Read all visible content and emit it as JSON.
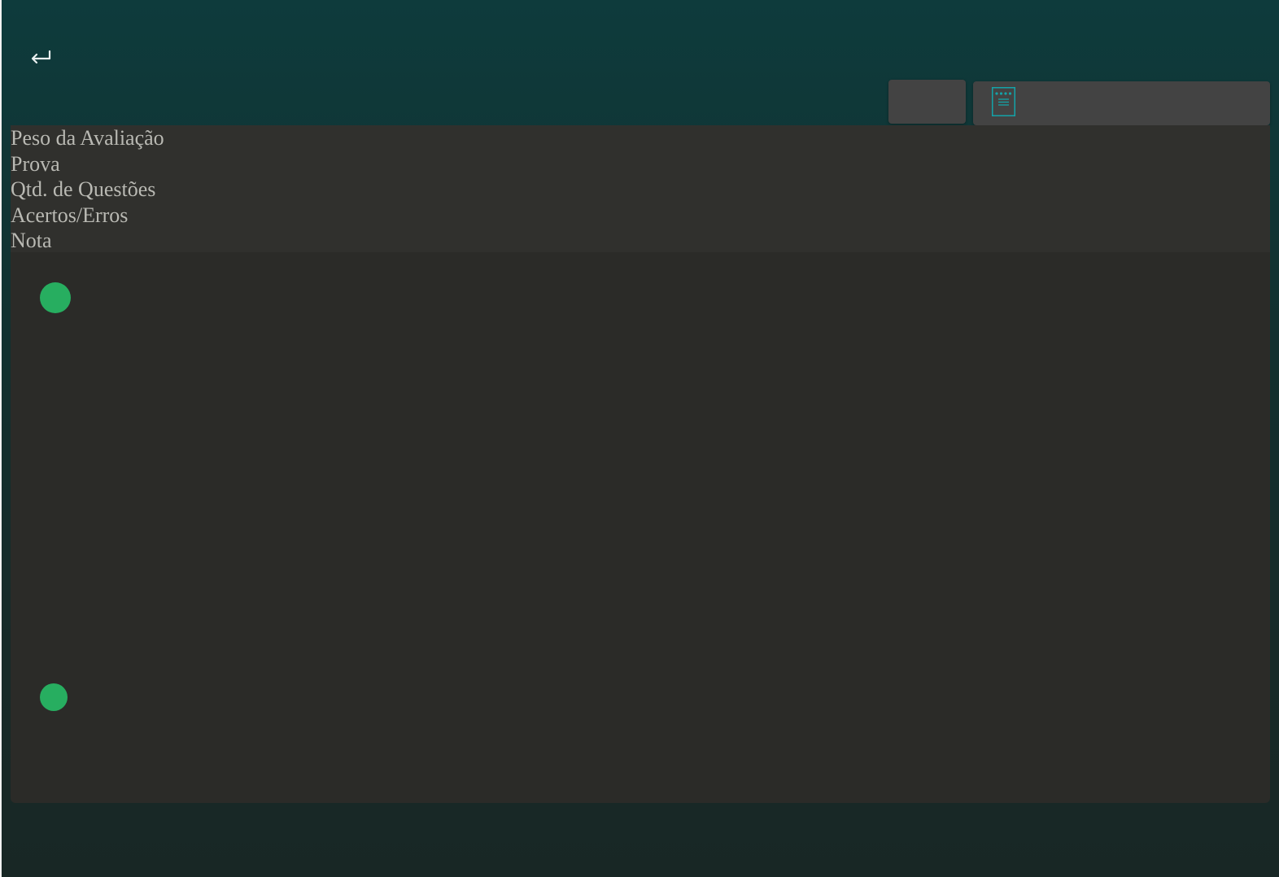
{
  "header": {
    "back_icon": "return-arrow-icon",
    "menu_icon": "document-list-icon"
  },
  "evaluation_info": {
    "fields": [
      "Peso da Avaliação",
      "Prova",
      "Qtd. de Questões",
      "Acertos/Erros",
      "Nota"
    ]
  },
  "colors": {
    "background_top": "#0e3b3c",
    "background_bottom": "#182725",
    "panel": "#30302d",
    "content_panel": "#2b2b28",
    "button": "#434343",
    "status_dot": "#27ae60",
    "icon_accent": "#13a3a8"
  }
}
